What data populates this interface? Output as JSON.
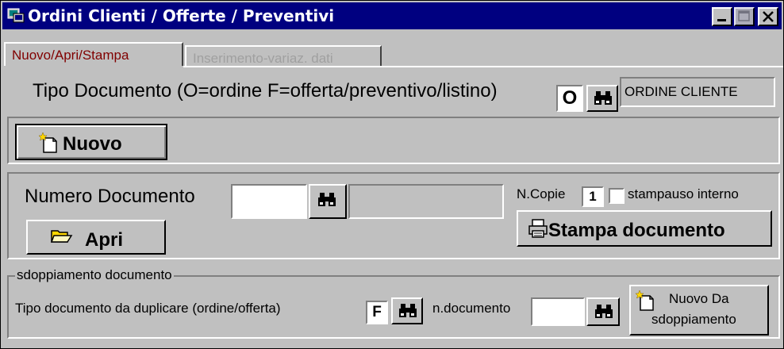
{
  "window": {
    "title": "Ordini Clienti / Offerte / Preventivi"
  },
  "tabs": [
    {
      "label": "Nuovo/Apri/Stampa"
    },
    {
      "label": "Inserimento-variaz. dati"
    }
  ],
  "tipo_documento": {
    "label": "Tipo Documento (O=ordine F=offerta/preventivo/listino)",
    "value": "O",
    "description": "ORDINE CLIENTE"
  },
  "nuovo_button": {
    "label": "Nuovo"
  },
  "apri_section": {
    "numero_label": "Numero Documento",
    "numero_value": "",
    "ncopie_label": "N.Copie",
    "ncopie_value": "1",
    "stampa_uso_interno_label": "stampauso interno",
    "apri_label": "Apri",
    "stampa_label": "Stampa documento"
  },
  "sdoppiamento": {
    "group_label": "sdoppiamento documento",
    "tipo_label": "Tipo documento da duplicare (ordine/offerta)",
    "tipo_value": "F",
    "ndoc_label": "n.documento",
    "ndoc_value": "",
    "nuovo_da_line1": "Nuovo Da",
    "nuovo_da_line2": "sdoppiamento"
  }
}
